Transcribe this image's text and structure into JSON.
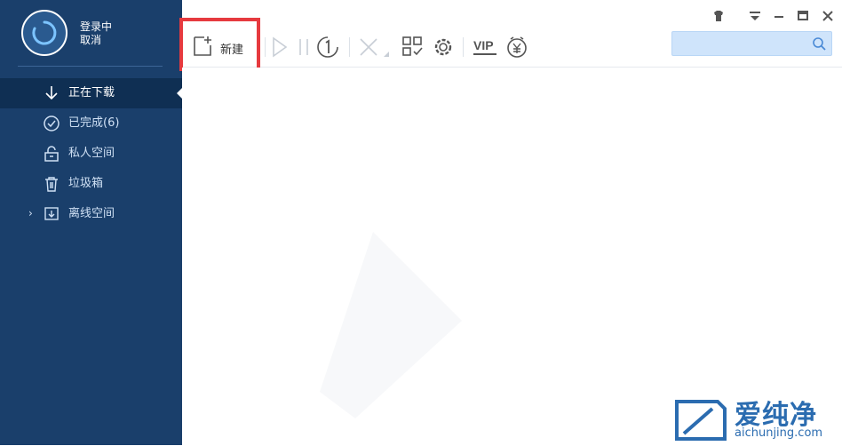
{
  "user": {
    "status": "登录中",
    "cancel_label": "取消"
  },
  "sidebar": {
    "items": [
      {
        "label": "正在下载",
        "icon": "download-icon",
        "active": true
      },
      {
        "label": "已完成(6)",
        "icon": "check-circle-icon",
        "active": false
      },
      {
        "label": "私人空间",
        "icon": "lock-icon",
        "active": false
      },
      {
        "label": "垃圾箱",
        "icon": "trash-icon",
        "active": false
      },
      {
        "label": "离线空间",
        "icon": "offline-space-icon",
        "active": false,
        "expandable": true
      }
    ]
  },
  "toolbar": {
    "new_label": "新建",
    "buttons": [
      {
        "name": "start",
        "icon": "play-icon",
        "enabled": false
      },
      {
        "name": "pause",
        "icon": "pause-icon",
        "enabled": false
      },
      {
        "name": "speed-limit",
        "icon": "speed-one-icon",
        "enabled": true
      },
      {
        "name": "delete",
        "icon": "delete-x-icon",
        "enabled": false
      },
      {
        "name": "apps",
        "icon": "apps-grid-icon",
        "enabled": true
      },
      {
        "name": "settings",
        "icon": "gear-icon",
        "enabled": true
      },
      {
        "name": "vip",
        "icon": "vip-icon",
        "enabled": true
      },
      {
        "name": "wallet",
        "icon": "yuan-icon",
        "enabled": true
      }
    ]
  },
  "search": {
    "placeholder": "",
    "value": ""
  },
  "window": {
    "controls": [
      "skin-icon",
      "menu-icon",
      "minimize-icon",
      "maximize-icon",
      "close-icon"
    ]
  },
  "watermark": {
    "text_cn": "爱纯净",
    "text_en": "aichunjing.com"
  },
  "colors": {
    "sidebar_bg": "#1a3f6b",
    "sidebar_active": "#0f2f53",
    "highlight": "#e63a3f",
    "search_bg": "#cfe4fb",
    "brand": "#2b6cb0"
  }
}
